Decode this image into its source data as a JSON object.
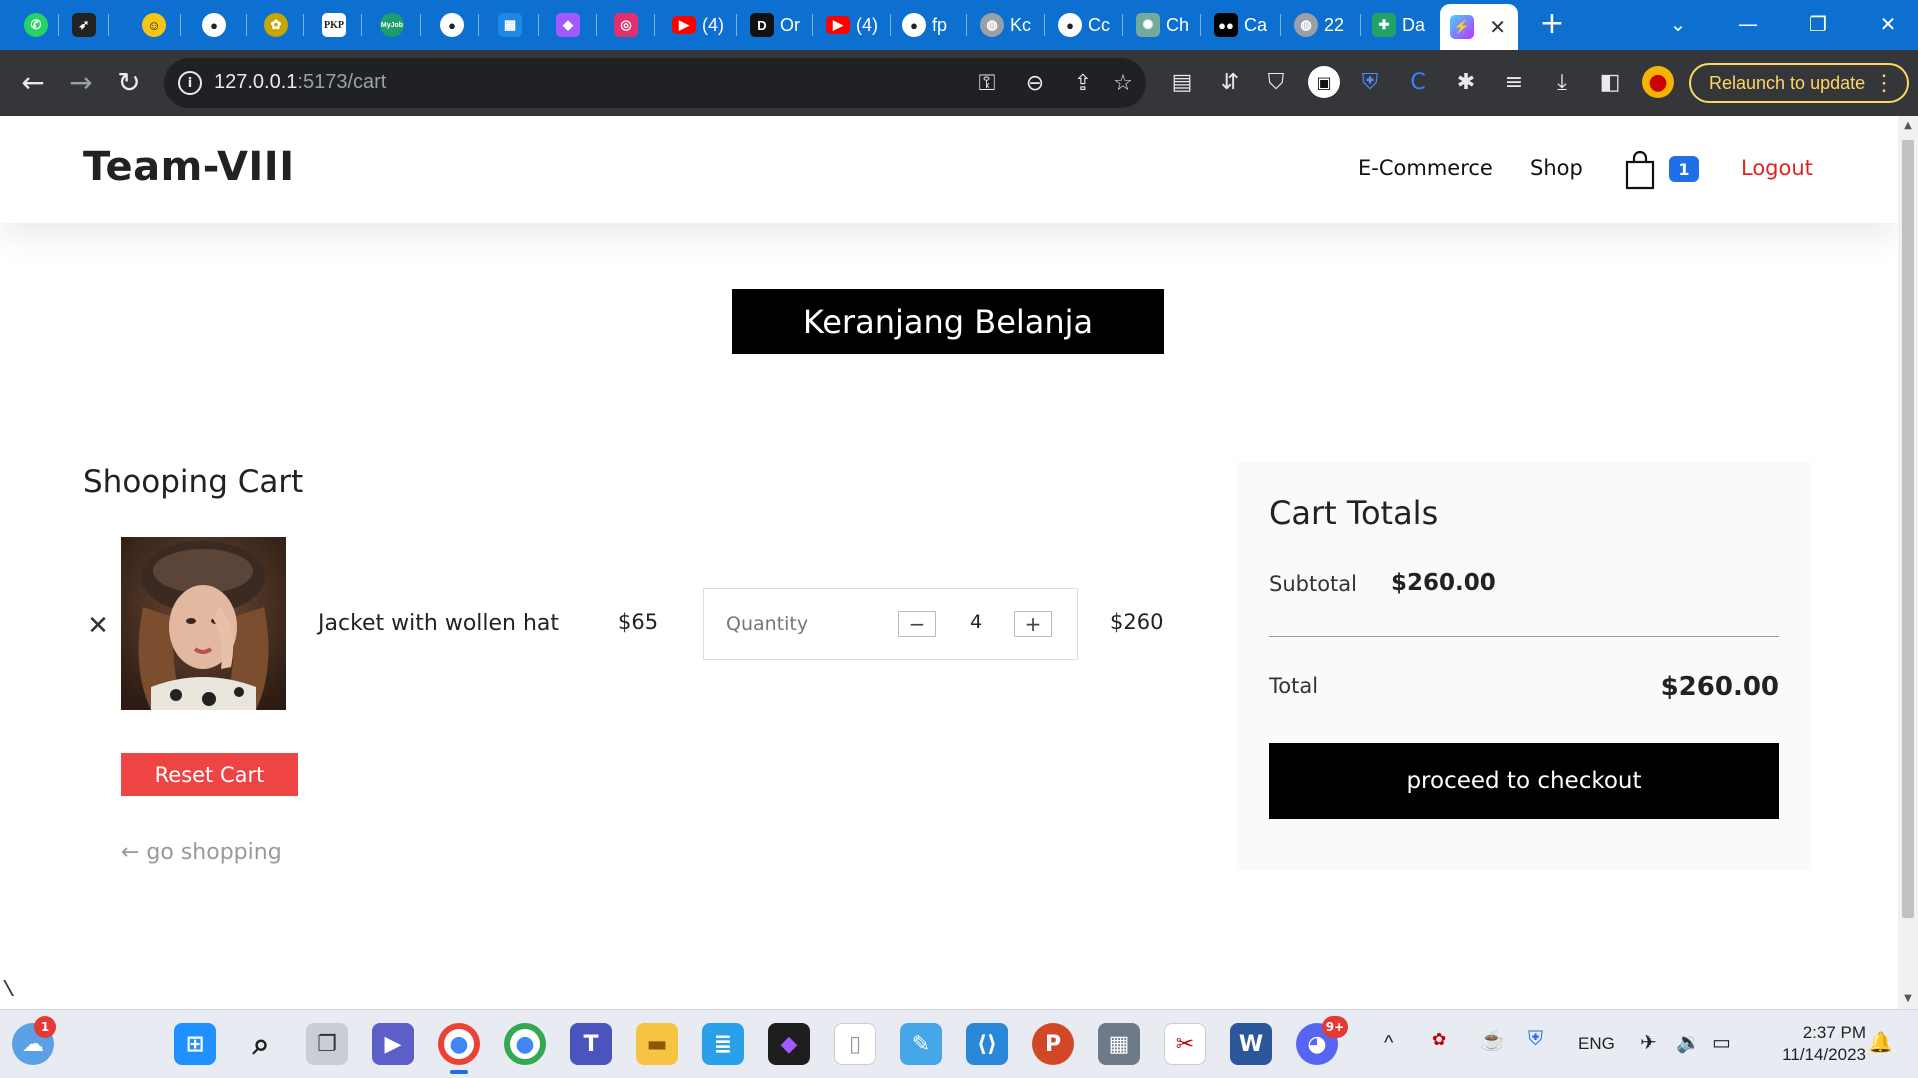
{
  "browser": {
    "tabs": [
      {
        "label": "",
        "icon": "whatsapp-icon",
        "color": "#25d366"
      },
      {
        "label": "",
        "icon": "compass-icon",
        "color": "#222222"
      },
      {
        "label": "",
        "icon": "smiley-icon",
        "color": "#f5c518"
      },
      {
        "label": "",
        "icon": "github-icon",
        "color": "#222222"
      },
      {
        "label": "",
        "icon": "emblem-icon",
        "color": "#c8a600"
      },
      {
        "label": "",
        "icon": "pkp-icon",
        "color": "#ffffff"
      },
      {
        "label": "",
        "icon": "myjob-icon",
        "color": "#1e9e6b"
      },
      {
        "label": "",
        "icon": "github-icon",
        "color": "#222222"
      },
      {
        "label": "",
        "icon": "calendar-icon",
        "color": "#1e88e5"
      },
      {
        "label": "",
        "icon": "figma-icon",
        "color": "#a259ff"
      },
      {
        "label": "",
        "icon": "instagram-icon",
        "color": "#e1306c"
      },
      {
        "label": "(4)",
        "icon": "youtube-icon",
        "color": "#ff0000"
      },
      {
        "label": "Or",
        "icon": "d-icon",
        "color": "#111111"
      },
      {
        "label": "(4)",
        "icon": "youtube-icon",
        "color": "#ff0000"
      },
      {
        "label": "fp",
        "icon": "github-icon",
        "color": "#222222"
      },
      {
        "label": "Kc",
        "icon": "globe-icon",
        "color": "#9aa0a6"
      },
      {
        "label": "Cc",
        "icon": "github-icon",
        "color": "#222222"
      },
      {
        "label": "Ch",
        "icon": "chatgpt-icon",
        "color": "#74aa9c"
      },
      {
        "label": "Ca",
        "icon": "medium-icon",
        "color": "#000000"
      },
      {
        "label": "22",
        "icon": "globe-icon",
        "color": "#9aa0a6"
      },
      {
        "label": "Da",
        "icon": "plus-green-icon",
        "color": "#21a366"
      }
    ],
    "active_tab_close": "✕",
    "new_tab": "+",
    "url_host": "127.0.0.1",
    "url_path": ":5173/cart",
    "relaunch_label": "Relaunch to update"
  },
  "site": {
    "brand": "Team-VIII",
    "nav": [
      "E-Commerce",
      "Shop"
    ],
    "cart_count": "1",
    "logout": "Logout"
  },
  "banner": "Keranjang Belanja",
  "cart": {
    "heading": "Shooping Cart",
    "items": [
      {
        "name": "Jacket with wollen hat",
        "price": "$65",
        "quantity_label": "Quantity",
        "quantity": "4",
        "line_total": "$260"
      }
    ],
    "reset_label": "Reset Cart",
    "go_shopping": "← go shopping"
  },
  "totals": {
    "title": "Cart Totals",
    "subtotal_label": "Subtotal",
    "subtotal_value": "$260.00",
    "total_label": "Total",
    "total_value": "$260.00",
    "checkout_label": "proceed to checkout"
  },
  "stray_char": "\\",
  "taskbar": {
    "language": "ENG",
    "time": "2:37 PM",
    "date": "11/14/2023",
    "weather_badge": "1",
    "discord_badge": "9+"
  },
  "colors": {
    "chrome_tabbar": "#0d6fcf",
    "toolbar": "#35363a",
    "accent_blue": "#1e6fe8",
    "logout_red": "#e02424",
    "reset_red": "#ee4444",
    "relaunch_yellow": "#fdd663"
  }
}
